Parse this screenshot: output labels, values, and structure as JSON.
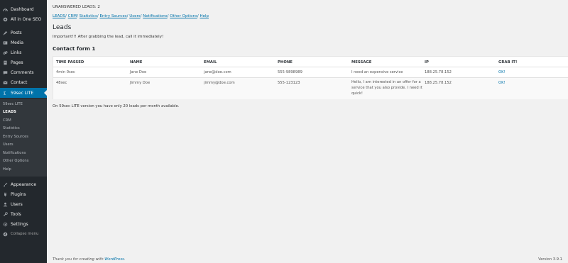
{
  "sidebar": {
    "items": [
      {
        "label": "Dashboard",
        "icon": "dashboard-icon"
      },
      {
        "label": "All in One SEO",
        "icon": "seo-icon"
      },
      {
        "label": "Posts",
        "icon": "pin-icon"
      },
      {
        "label": "Media",
        "icon": "media-icon"
      },
      {
        "label": "Links",
        "icon": "link-icon"
      },
      {
        "label": "Pages",
        "icon": "page-icon"
      },
      {
        "label": "Comments",
        "icon": "comment-icon"
      },
      {
        "label": "Contact",
        "icon": "mail-icon"
      },
      {
        "label": "59sec LITE",
        "icon": "clock-icon"
      },
      {
        "label": "Appearance",
        "icon": "brush-icon"
      },
      {
        "label": "Plugins",
        "icon": "plugin-icon"
      },
      {
        "label": "Users",
        "icon": "user-icon"
      },
      {
        "label": "Tools",
        "icon": "wrench-icon"
      },
      {
        "label": "Settings",
        "icon": "settings-icon"
      },
      {
        "label": "Collapse menu",
        "icon": "collapse-icon"
      }
    ],
    "submenu": [
      "59sec LITE",
      "LEADS",
      "CRM",
      "Statistics",
      "Entry Sources",
      "Users",
      "Notifications",
      "Other Options",
      "Help"
    ],
    "colors": {
      "background": "#23282d",
      "active": "#0073aa",
      "submenu": "#32373c"
    }
  },
  "main": {
    "unanswered": "UNANSWERED LEADS: 2",
    "nav": [
      "LEADS",
      "CRM",
      "Statistics",
      "Entry Sources",
      "Users",
      "Notifications",
      "Other Options",
      "Help"
    ],
    "title": "Leads",
    "important": "Important!!! After grabbing the lead, call it immediately!",
    "form_title": "Contact form 1",
    "table": {
      "headers": [
        "TIME PASSED",
        "NAME",
        "EMAIL",
        "PHONE",
        "MESSAGE",
        "IP",
        "GRAB IT!"
      ],
      "rows": [
        [
          "4min 0sec",
          "Jane Doe",
          "jane@doe.com",
          "555-9898989",
          "I need an expensive service",
          "188.25.78.152",
          "OK!"
        ],
        [
          "48sec",
          "Jimmy Doe",
          "jimmy@doe.com",
          "555-123123",
          "Hello, I am interested in an offer for a service that you also provide. I need it quick!",
          "188.25.78.152",
          "OK!"
        ]
      ]
    },
    "lite_note": "On 59sec LITE version you have only 20 leads per month available."
  },
  "footer": {
    "thanks_prefix": "Thank you for creating with ",
    "thanks_link": "WordPress",
    "thanks_suffix": ".",
    "version": "Version 3.9.1"
  }
}
